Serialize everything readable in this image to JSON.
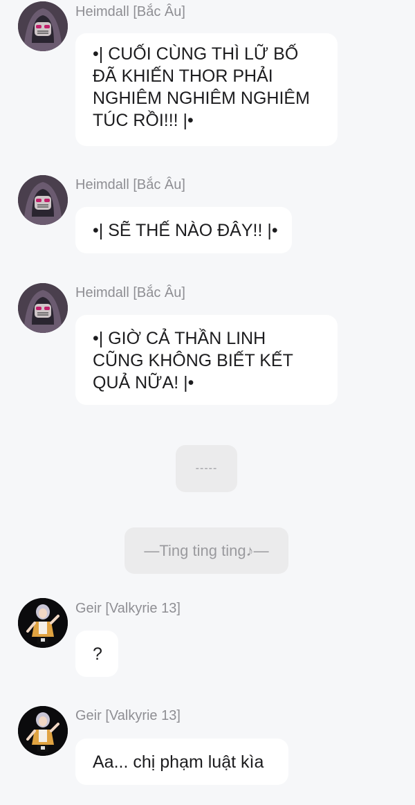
{
  "messages": [
    {
      "sender": "Heimdall [Bắc Âu]",
      "avatar_icon": "hooded-mask-avatar-icon",
      "lines": [
        "•|  CUỐI CÙNG THÌ LỮ BỐ",
        "ĐÃ KHIẾN THOR PHẢI",
        "NGHIÊM NGHIÊM NGHIÊM",
        "TÚC RỒI!!! |•"
      ]
    },
    {
      "sender": "Heimdall [Bắc Âu]",
      "avatar_icon": "hooded-mask-avatar-icon",
      "lines": [
        "•| SẼ THẾ NÀO ĐÂY!! |•"
      ]
    },
    {
      "sender": "Heimdall [Bắc Âu]",
      "avatar_icon": "hooded-mask-avatar-icon",
      "lines": [
        "•| GIỜ CẢ THẦN LINH",
        "CŨNG KHÔNG BIẾT KẾT",
        "QUẢ NỮA! |•"
      ]
    },
    {
      "sender": "Geir [Valkyrie 13]",
      "avatar_icon": "valkyrie-girl-avatar-icon",
      "lines": [
        "?"
      ]
    },
    {
      "sender": "Geir [Valkyrie 13]",
      "avatar_icon": "valkyrie-girl-avatar-icon",
      "lines": [
        "Aa... chị phạm luật kìa"
      ]
    }
  ],
  "system": {
    "divider": "-----",
    "notice": "—Ting ting ting♪—"
  },
  "colors": {
    "background": "#f6f7f9",
    "bubble": "#ffffff",
    "system_bubble": "#ebebec",
    "sender_text": "#8e8e93",
    "message_text": "#1c1c1e"
  }
}
